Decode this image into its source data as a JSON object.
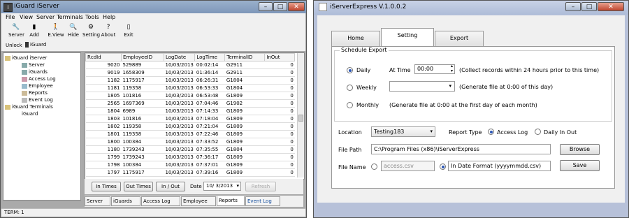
{
  "left_window": {
    "title": "iGuard iServer",
    "menu": [
      "File",
      "View",
      "Server",
      "Terminals",
      "Tools",
      "Help"
    ],
    "toolbar": [
      {
        "label": "Server",
        "icon": "server-icon"
      },
      {
        "label": "Add",
        "icon": "add-icon"
      },
      {
        "label": "E.View",
        "icon": "eview-icon"
      },
      {
        "label": "Hide",
        "icon": "search-icon"
      },
      {
        "label": "Setting",
        "icon": "setting-icon"
      },
      {
        "label": "About",
        "icon": "help-icon"
      },
      {
        "label": "Exit",
        "icon": "exit-icon"
      }
    ],
    "unlock_label": "Unlock",
    "unlock_value": "iGuard",
    "tree": {
      "root": "iGuard iServer",
      "children": [
        "Server",
        "iGuards",
        "Access Log",
        "Employee",
        "Reports",
        "Event Log"
      ],
      "root2": "iGuard Terminals",
      "children2": [
        "iGuard"
      ]
    },
    "grid": {
      "columns": [
        "RcdId",
        "EmployeeID",
        "LogDate",
        "LogTime",
        "TerminalID",
        "InOut"
      ],
      "rows": [
        [
          "9020",
          "529889",
          "10/03/2013",
          "00:02:14",
          "G2911",
          "0"
        ],
        [
          "9019",
          "1658309",
          "10/03/2013",
          "01:36:14",
          "G2911",
          "0"
        ],
        [
          "1182",
          "1175917",
          "10/03/2013",
          "06:26:31",
          "G1804",
          "0"
        ],
        [
          "1181",
          "119358",
          "10/03/2013",
          "06:53:33",
          "G1804",
          "0"
        ],
        [
          "1805",
          "101816",
          "10/03/2013",
          "06:53:48",
          "G1809",
          "0"
        ],
        [
          "2565",
          "1697369",
          "10/03/2013",
          "07:04:46",
          "G1902",
          "0"
        ],
        [
          "1804",
          "6989",
          "10/03/2013",
          "07:14:33",
          "G1809",
          "0"
        ],
        [
          "1803",
          "101816",
          "10/03/2013",
          "07:18:04",
          "G1809",
          "0"
        ],
        [
          "1802",
          "119358",
          "10/03/2013",
          "07:21:04",
          "G1809",
          "0"
        ],
        [
          "1801",
          "119358",
          "10/03/2013",
          "07:22:46",
          "G1809",
          "0"
        ],
        [
          "1800",
          "100384",
          "10/03/2013",
          "07:33:52",
          "G1809",
          "0"
        ],
        [
          "1180",
          "1739243",
          "10/03/2013",
          "07:35:55",
          "G1804",
          "0"
        ],
        [
          "1799",
          "1739243",
          "10/03/2013",
          "07:36:17",
          "G1809",
          "0"
        ],
        [
          "1798",
          "100384",
          "10/03/2013",
          "07:37:01",
          "G1809",
          "0"
        ],
        [
          "1797",
          "1175917",
          "10/03/2013",
          "07:39:16",
          "G1809",
          "0"
        ]
      ]
    },
    "buttons": {
      "in_times": "In Times",
      "out_times": "Out Times",
      "in_out": "In / Out",
      "date_label": "Date",
      "date_value": "10/ 3/2013",
      "refresh": "Refresh"
    },
    "tabs": [
      "Server",
      "iGuards",
      "Access Log",
      "Employee",
      "Reports",
      "Event Log"
    ],
    "status": "TERM: 1"
  },
  "right_window": {
    "title": "iServerExpress V.1.0.0.2",
    "tabs": [
      "Home",
      "Setting",
      "Export"
    ],
    "schedule_group": "Schedule Export",
    "daily": "Daily",
    "at_time_label": "At Time",
    "time_value": "00:00",
    "daily_note": "(Collect records within 24 hours prior to this time)",
    "weekly": "Weekly",
    "weekly_note": "(Generate file at 0:00 of this day)",
    "monthly": "Monthly",
    "monthly_note": "(Generate file at 0:00 at the first day of each month)",
    "location_label": "Location",
    "location_value": "Testing183",
    "report_type_label": "Report Type",
    "access_log": "Access Log",
    "daily_inout": "Daily In Out",
    "file_path_label": "File Path",
    "file_path_value": "C:\\Program Files (x86)\\iServerExpress",
    "browse": "Browse",
    "file_name_label": "File Name",
    "file_name_value": "access.csv",
    "date_format_value": "In Date Format (yyyymmdd.csv)",
    "save": "Save"
  }
}
